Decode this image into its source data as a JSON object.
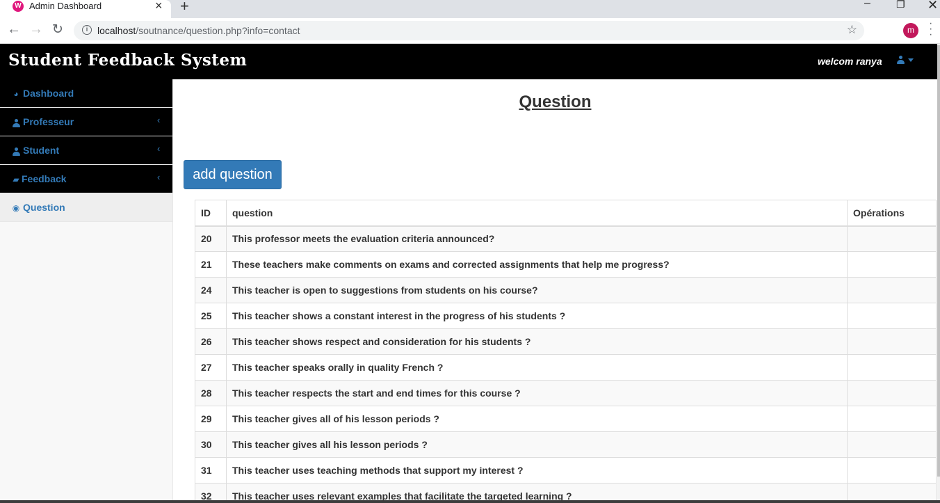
{
  "browser": {
    "tab_title": "Admin Dashboard",
    "tab_favicon": "W",
    "url_host": "localhost",
    "url_path": "/soutnance/question.php?info=contact",
    "profile_initial": "m"
  },
  "header": {
    "brand": "Student Feedback System",
    "welcome": "welcom ranya"
  },
  "sidebar": {
    "items": [
      {
        "label": "Dashboard",
        "icon": "dashboard-icon",
        "submenu": false
      },
      {
        "label": "Professeur",
        "icon": "user-icon",
        "submenu": true
      },
      {
        "label": "Student",
        "icon": "user-icon",
        "submenu": true
      },
      {
        "label": "Feedback",
        "icon": "book-icon",
        "submenu": true
      },
      {
        "label": "Question",
        "icon": "eye-icon",
        "submenu": false
      }
    ]
  },
  "main": {
    "title": "Question",
    "add_button": "add question",
    "table": {
      "columns": [
        "ID",
        "question",
        "Opérations"
      ],
      "rows": [
        {
          "id": "20",
          "question": "This professor meets the evaluation criteria announced?"
        },
        {
          "id": "21",
          "question": "These teachers make comments on exams and corrected assignments that help me progress?"
        },
        {
          "id": "24",
          "question": "This teacher is open to suggestions from students on his course?"
        },
        {
          "id": "25",
          "question": "This teacher shows a constant interest in the progress of his students ?"
        },
        {
          "id": "26",
          "question": "This teacher shows respect and consideration for his students ?"
        },
        {
          "id": "27",
          "question": "This teacher speaks orally in quality French ?"
        },
        {
          "id": "28",
          "question": "This teacher respects the start and end times for this course ?"
        },
        {
          "id": "29",
          "question": "This teacher gives all of his lesson periods ?"
        },
        {
          "id": "30",
          "question": "This teacher gives all his lesson periods ?"
        },
        {
          "id": "31",
          "question": "This teacher uses teaching methods that support my interest ?"
        },
        {
          "id": "32",
          "question": "This teacher uses relevant examples that facilitate the targeted learning ?"
        }
      ]
    }
  },
  "colors": {
    "link": "#337ab7",
    "header_bg": "#000000",
    "button_bg": "#337ab7"
  }
}
